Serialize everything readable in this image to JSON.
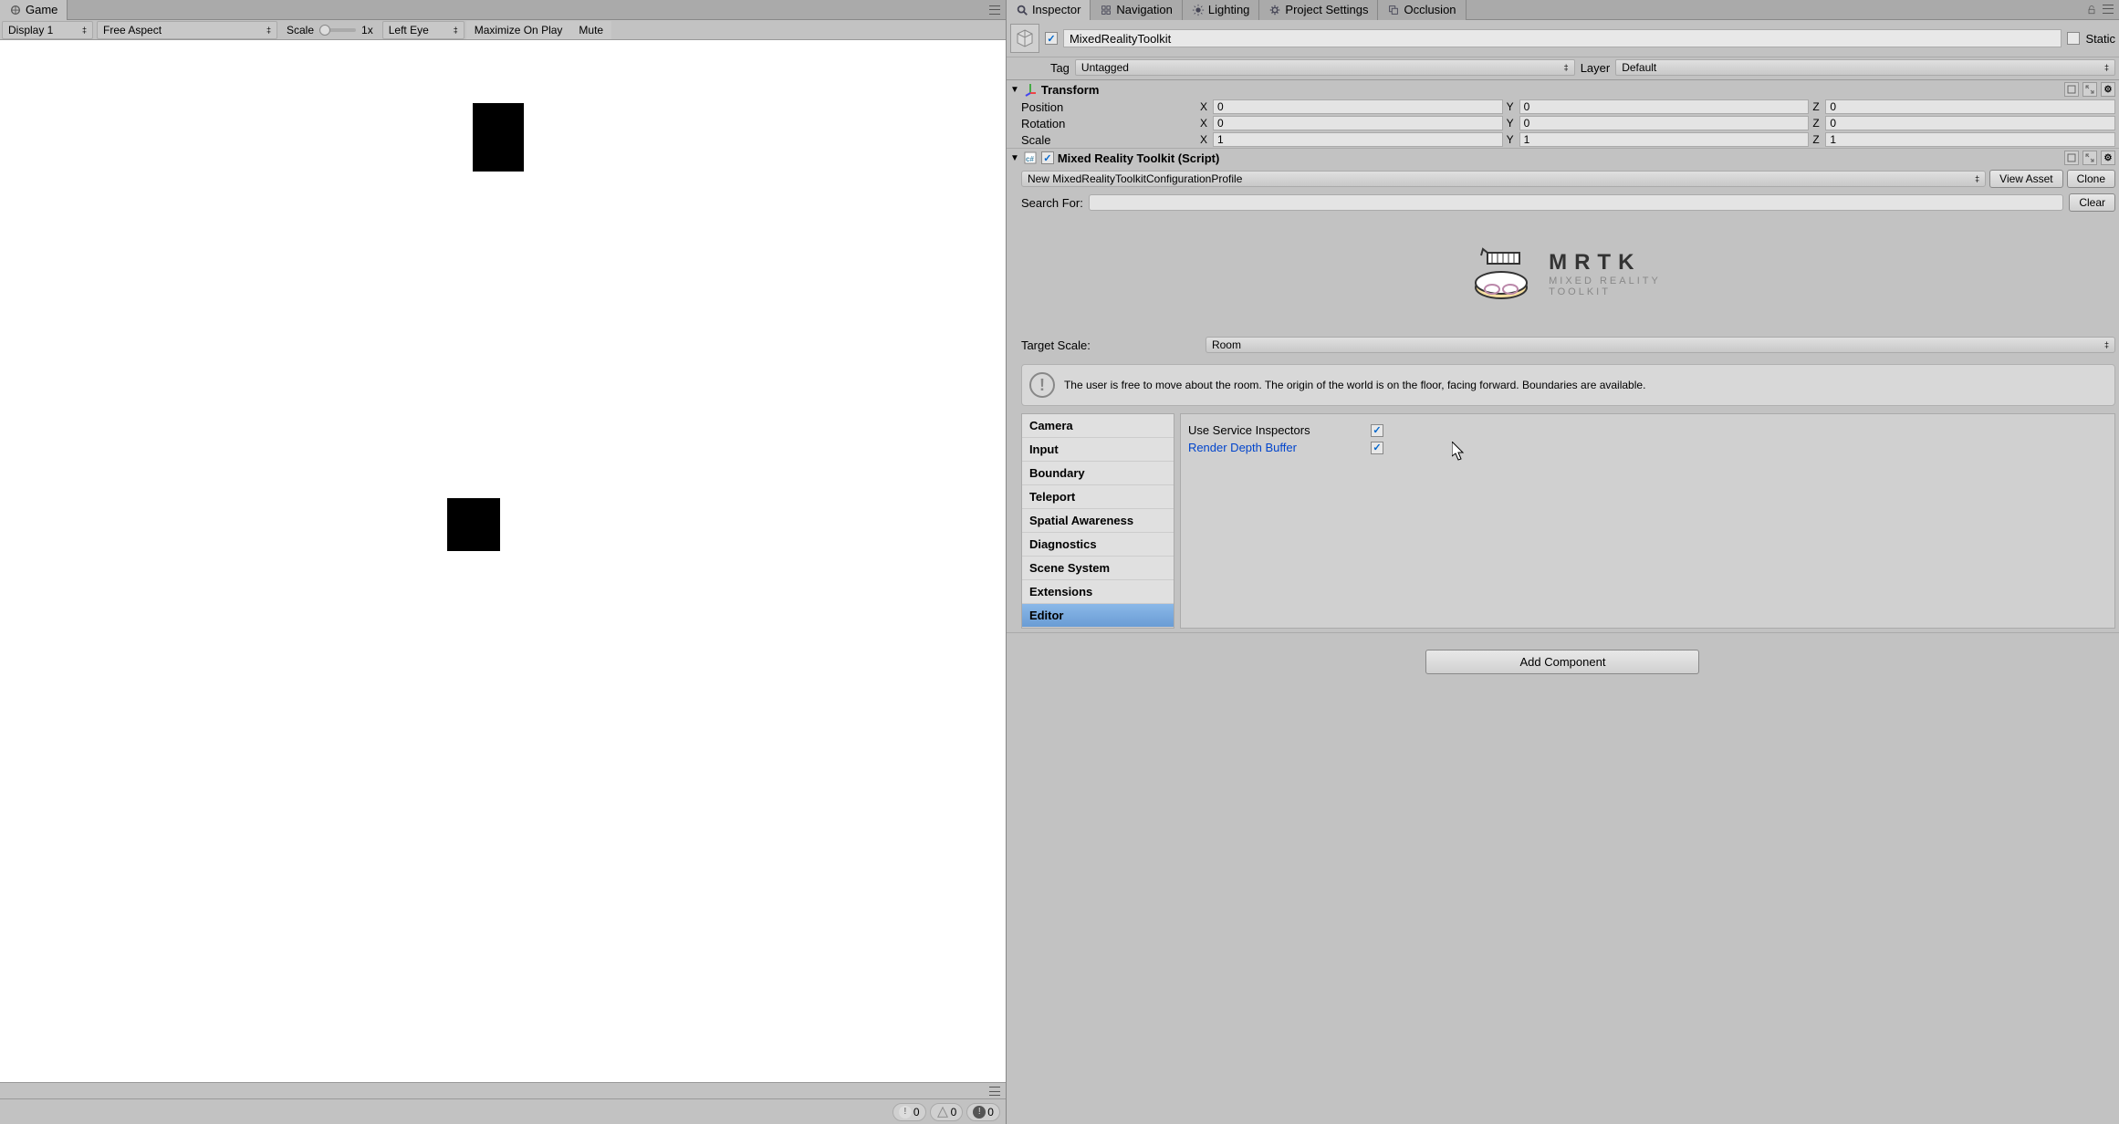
{
  "left": {
    "tab": "Game",
    "display": "Display 1",
    "aspect": "Free Aspect",
    "scale_label": "Scale",
    "scale_value": "1x",
    "eye": "Left Eye",
    "maximize": "Maximize On Play",
    "mute": "Mute"
  },
  "console": {
    "info_count": "0",
    "warn_count": "0",
    "error_count": "0"
  },
  "inspector": {
    "tabs": [
      "Inspector",
      "Navigation",
      "Lighting",
      "Project Settings",
      "Occlusion"
    ],
    "gameobject_name": "MixedRealityToolkit",
    "static_label": "Static",
    "tag_label": "Tag",
    "tag_value": "Untagged",
    "layer_label": "Layer",
    "layer_value": "Default"
  },
  "transform": {
    "title": "Transform",
    "position_label": "Position",
    "rotation_label": "Rotation",
    "scale_label": "Scale",
    "position": {
      "x": "0",
      "y": "0",
      "z": "0"
    },
    "rotation": {
      "x": "0",
      "y": "0",
      "z": "0"
    },
    "scale": {
      "x": "1",
      "y": "1",
      "z": "1"
    }
  },
  "mrtk": {
    "title": "Mixed Reality Toolkit (Script)",
    "profile": "New MixedRealityToolkitConfigurationProfile",
    "view_asset": "View Asset",
    "clone": "Clone",
    "search_label": "Search For:",
    "clear": "Clear",
    "logo_title": "MRTK",
    "logo_sub1": "MIXED REALITY",
    "logo_sub2": "TOOLKIT",
    "target_scale_label": "Target Scale:",
    "target_scale_value": "Room",
    "info_text": "The user is free to move about the room. The origin of the world is on the floor, facing forward. Boundaries are available.",
    "tabs": [
      "Camera",
      "Input",
      "Boundary",
      "Teleport",
      "Spatial Awareness",
      "Diagnostics",
      "Scene System",
      "Extensions",
      "Editor"
    ],
    "selected_tab": "Editor",
    "editor_props": {
      "use_inspectors": "Use Service Inspectors",
      "render_depth": "Render Depth Buffer"
    },
    "add_component": "Add Component"
  }
}
